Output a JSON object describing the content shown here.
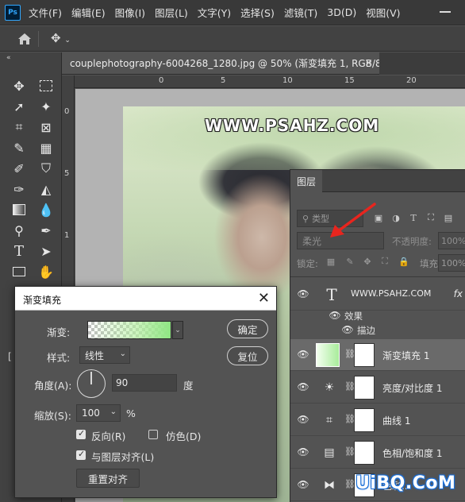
{
  "menubar": {
    "logo": "Ps",
    "items": [
      "文件(F)",
      "编辑(E)",
      "图像(I)",
      "图层(L)",
      "文字(Y)",
      "选择(S)",
      "滤镜(T)",
      "3D(D)",
      "视图(V)"
    ]
  },
  "document": {
    "tab_title": "couplephotography-6004268_1280.jpg @ 50% (渐变填充 1, RGB/8#) *",
    "close_glyph": "×",
    "ruler_h_marks": [
      "0",
      "5",
      "10",
      "15",
      "20",
      "25",
      "30"
    ],
    "ruler_v_marks": [
      "0",
      "5",
      "1"
    ],
    "canvas_text": "WWW.PSAHZ.COM"
  },
  "layers_panel": {
    "tab_label": "图层",
    "kind_filter_placeholder": "类型",
    "blend_mode": "柔光",
    "opacity_label": "不透明度:",
    "opacity_value": "100%",
    "lock_label": "锁定:",
    "fill_label": "填充:",
    "fill_value": "100%",
    "layers": [
      {
        "name": "WWW.PSAHZ.COM",
        "kind": "type",
        "fx": "fx"
      },
      {
        "name": "渐变填充 1",
        "kind": "gradient-fill",
        "selected": true
      },
      {
        "name": "亮度/对比度 1",
        "kind": "brightness-contrast"
      },
      {
        "name": "曲线 1",
        "kind": "curves"
      },
      {
        "name": "色相/饱和度 1",
        "kind": "hue-saturation"
      },
      {
        "name": "色彩...",
        "kind": "color-balance"
      }
    ],
    "effects_label": "效果",
    "stroke_label": "描边"
  },
  "dialog": {
    "title": "渐变填充",
    "gradient_label": "渐变:",
    "style_label": "样式:",
    "style_value": "线性",
    "angle_label": "角度(A):",
    "angle_value": "90",
    "angle_unit": "度",
    "scale_label": "缩放(S):",
    "scale_value": "100",
    "scale_unit": "%",
    "reverse_label": "反向(R)",
    "reverse_checked": true,
    "dither_label": "仿色(D)",
    "dither_checked": false,
    "align_label": "与图层对齐(L)",
    "align_checked": true,
    "reset_align_label": "重置对齐",
    "ok_label": "确定",
    "reset_label": "复位"
  },
  "site_watermark": "UiBQ.CoM",
  "colors": {
    "accent_blue": "#31a8ff",
    "annotation_red": "#e8251e",
    "gradient_end": "#8fe683"
  }
}
